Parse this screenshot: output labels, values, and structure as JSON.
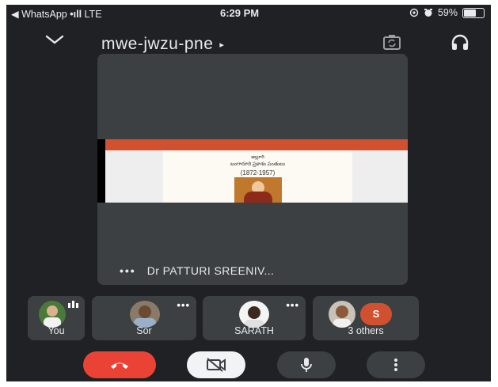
{
  "status_bar": {
    "back_app": "◀ WhatsApp",
    "signal": "•ıll",
    "network": "LTE",
    "time": "6:29 PM",
    "battery_percent": "59%",
    "battery_level": 0.59
  },
  "header": {
    "meeting_code": "mwe-jwzu-pne",
    "code_arrow": "▸",
    "icons": [
      "chevron-down-icon",
      "switch-camera-icon",
      "headphones-icon"
    ]
  },
  "main_tile": {
    "more_label": "•••",
    "presenter_name": "Dr PATTURI SREENIV...",
    "shared_screen": {
      "line1": "అల్లూరి",
      "line2": "బంగారూరి ప్రకాశం పంతులు",
      "years": "(1872-1957)"
    }
  },
  "participants": [
    {
      "name": "You",
      "indicator": "speaking-bars-icon"
    },
    {
      "name": "Sor",
      "more": "•••"
    },
    {
      "name": "SARATH",
      "more": "•••"
    },
    {
      "name": "3 others",
      "badge": "S"
    }
  ],
  "controls": [
    "hang-up-icon",
    "camera-off-icon",
    "microphone-icon",
    "more-options-icon"
  ],
  "colors": {
    "background": "#202124",
    "tile": "#3c4043",
    "hangup": "#ea4335",
    "accent_orange": "#d0502f",
    "text": "#e8eaed"
  }
}
